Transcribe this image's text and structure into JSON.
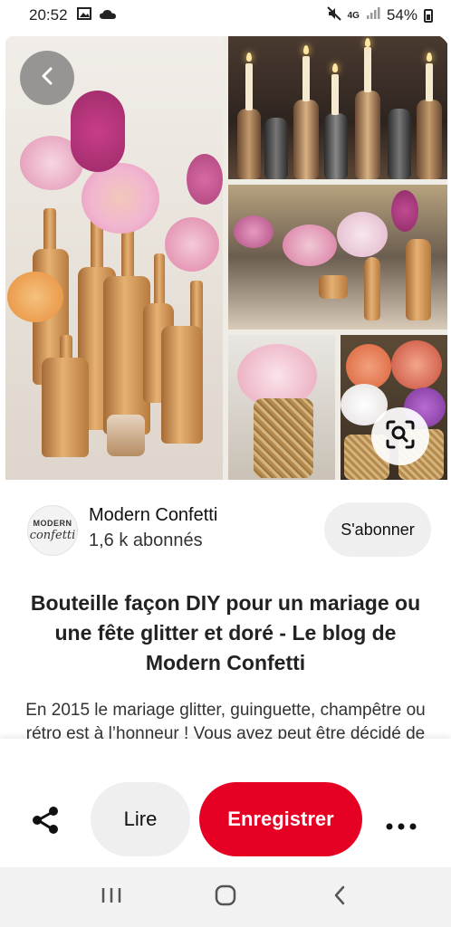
{
  "status_bar": {
    "time": "20:52",
    "network": "4G",
    "battery": "54%",
    "icons": [
      "image-icon",
      "cloud-icon",
      "mute-icon",
      "signal-icon",
      "battery-icon"
    ]
  },
  "pin": {
    "image_alt": "Bouteilles dorées et fleurs",
    "back_icon": "chevron-left-icon",
    "lens_icon": "visual-search-icon"
  },
  "creator": {
    "avatar_line1": "MODERN",
    "avatar_line2": "confetti",
    "name": "Modern Confetti",
    "followers": "1,6 k abonnés",
    "follow_label": "S'abonner"
  },
  "title": "Bouteille façon DIY pour un mariage ou une fête glitter et doré - Le blog de Modern Confetti",
  "description": "En 2015 le mariage glitter, guinguette, champêtre ou rétro est à l’honneur ! Vous avez peut être décidé de vous inspirer d’un",
  "actions": {
    "share_icon": "share-icon",
    "read_label": "Lire",
    "save_label": "Enregistrer",
    "more_icon": "more-horizontal-icon"
  },
  "nav": {
    "recents_icon": "recents-icon",
    "home_icon": "home-icon",
    "back_icon": "back-icon"
  },
  "colors": {
    "save_button": "#e60023",
    "pill_button": "#efefef"
  }
}
